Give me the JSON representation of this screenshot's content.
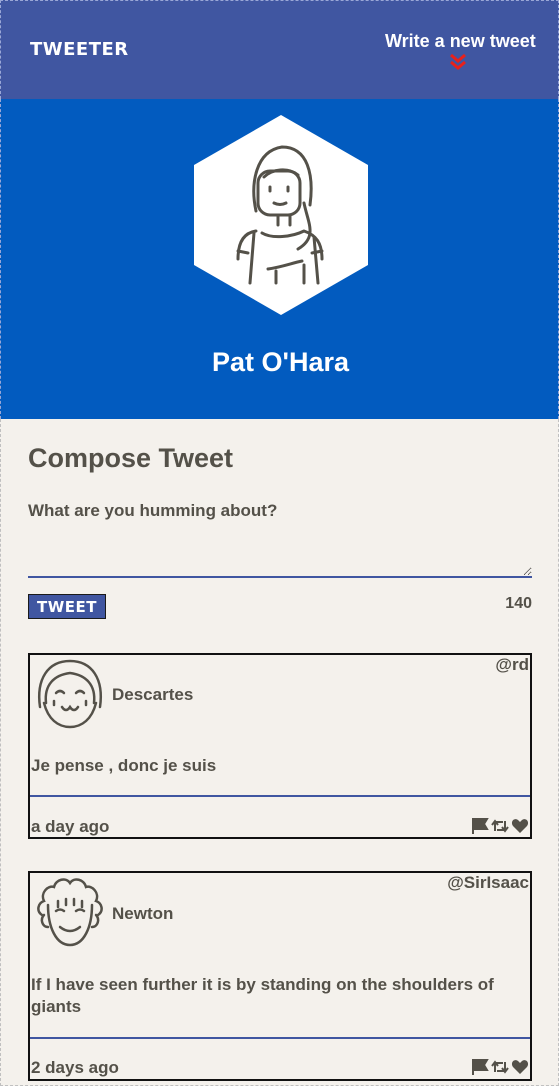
{
  "nav": {
    "logo": "TWEETER",
    "write_label": "Write a new tweet",
    "accent": "#e8211b"
  },
  "profile": {
    "name": "Pat O'Hara"
  },
  "compose": {
    "title": "Compose Tweet",
    "placeholder": "What are you humming about?",
    "button_label": "TWEET",
    "counter": "140"
  },
  "tweets": [
    {
      "name": "Descartes",
      "handle": "@rd",
      "text": "Je pense , donc je suis",
      "time": "a day ago",
      "avatar": "girl-avatar-icon"
    },
    {
      "name": "Newton",
      "handle": "@SirIsaac",
      "text": "If I have seen further it is by standing on the shoulders of giants",
      "time": "2 days ago",
      "avatar": "curly-hair-avatar-icon"
    }
  ],
  "colors": {
    "nav_bg": "#4056a1",
    "profile_bg": "#025bbf",
    "page_bg": "#f4f1ec",
    "text": "#545149"
  }
}
